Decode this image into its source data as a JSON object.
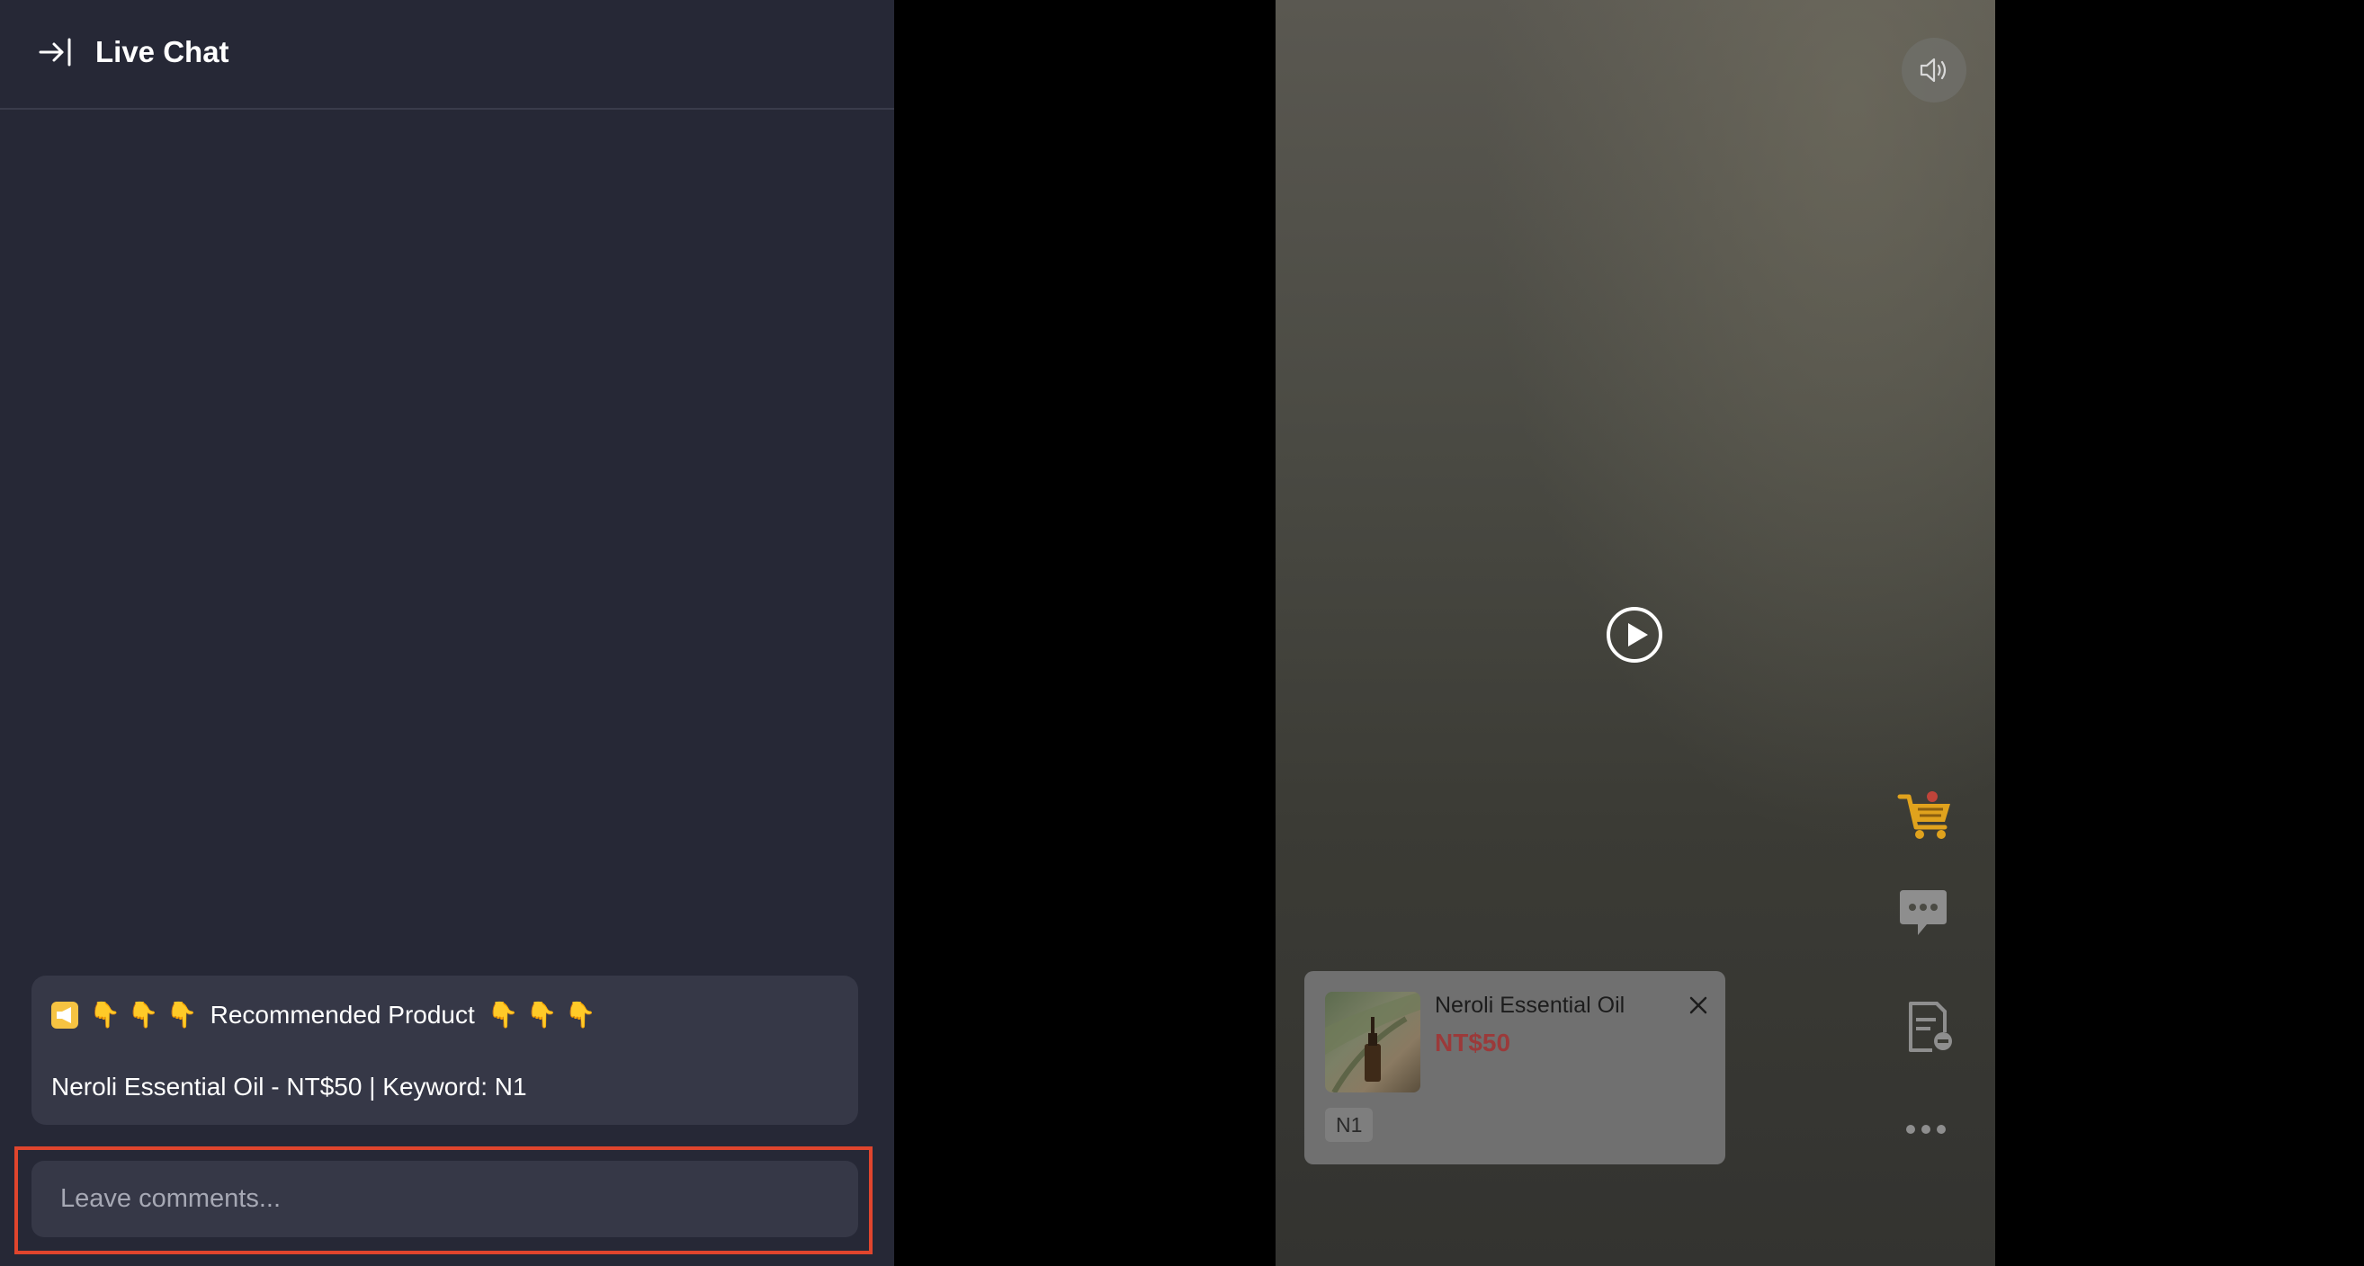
{
  "chat_panel": {
    "title": "Live Chat",
    "pinned_message": {
      "emojis_before": [
        "👇",
        "👇",
        "👇"
      ],
      "title": "Recommended Product",
      "emojis_after": [
        "👇",
        "👇",
        "👇"
      ],
      "body": "Neroli Essential Oil - NT$50 | Keyword: N1"
    },
    "comment_input": {
      "value": "",
      "placeholder": "Leave comments..."
    }
  },
  "video": {
    "state": "paused",
    "mute_icon": "speaker-icon",
    "side_icons": [
      "cart-icon",
      "chat-bubble-icon",
      "order-list-icon",
      "more-icon"
    ]
  },
  "product_card": {
    "name": "Neroli Essential Oil",
    "price": "NT$50",
    "keyword": "N1"
  },
  "colors": {
    "panel_bg": "#262836",
    "card_bg": "#363847",
    "highlight_border": "#e0452d",
    "price": "#9b3a3a",
    "cart_accent": "#e0a21d"
  }
}
